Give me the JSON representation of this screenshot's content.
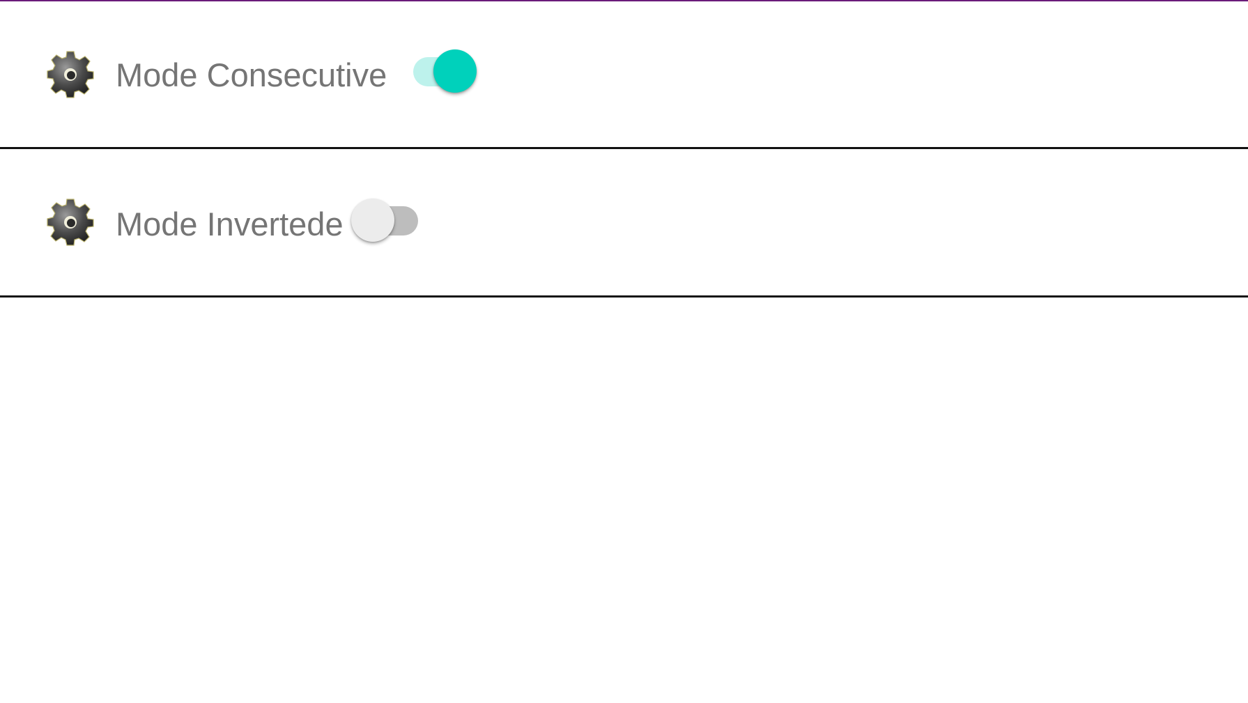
{
  "colors": {
    "accent": "#00d1bb",
    "accent_track": "#bdf2ec",
    "off_thumb": "#ececec",
    "off_track": "#bdbdbd",
    "label_text": "#757575",
    "divider": "#111111",
    "top_accent": "#6a1b7a"
  },
  "settings": [
    {
      "icon": "gear-icon",
      "label": "Mode Consecutive",
      "enabled": true
    },
    {
      "icon": "gear-icon",
      "label": "Mode Invertede",
      "enabled": false
    }
  ]
}
